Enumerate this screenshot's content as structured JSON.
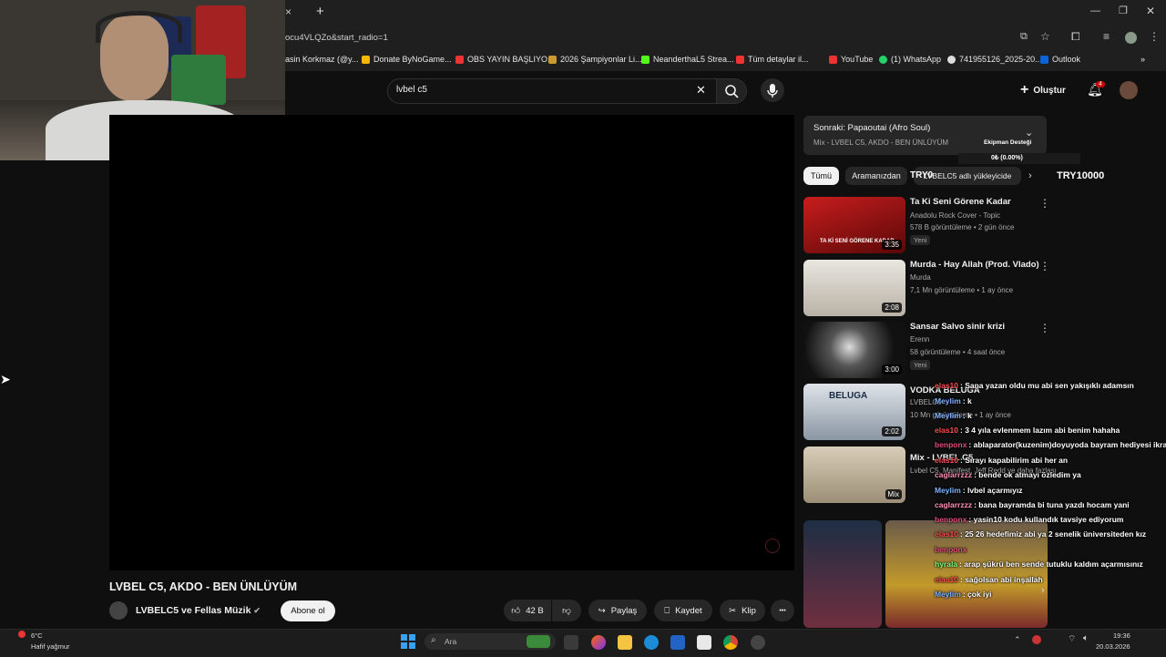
{
  "browser": {
    "url": "ocu4VLQZo&start_radio=1",
    "tab_close": "×",
    "new_tab": "+",
    "bookmarks": [
      {
        "label": "asin Korkmaz (@y...",
        "color": "#e33"
      },
      {
        "label": "Donate ByNoGame...",
        "color": "#f5b800"
      },
      {
        "label": "OBS YAYIN BAŞLIYO...",
        "color": "#e33"
      },
      {
        "label": "2026 Şampiyonlar Li...",
        "color": "#cc9a2e"
      },
      {
        "label": "NeanderthaL5 Strea...",
        "color": "#53fc18"
      },
      {
        "label": "Tüm detaylar il...",
        "color": "#e33"
      },
      {
        "label": "YouTube",
        "color": "#e33"
      },
      {
        "label": "(1) WhatsApp",
        "color": "#25d366"
      },
      {
        "label": "741955126_2025-20...",
        "color": "#ddd"
      },
      {
        "label": "Outlook",
        "color": "#0a64d8"
      }
    ]
  },
  "youtube": {
    "search_value": "lvbel c5",
    "create_label": "Oluştur",
    "notif_count": "4"
  },
  "up_next": {
    "title": "Sonraki: Papaoutai (Afro Soul)",
    "subtitle": "Mix - LVBEL C5, AKDO - BEN ÜNLÜYÜM",
    "team_label": "Ekipman Desteği",
    "progress_text": "0₺ (0.00%)"
  },
  "filters": {
    "all": "Tümü",
    "from_search": "Aramanızdan",
    "uploader": "LVBELC5 adlı yükleyicide",
    "donation_left": "TRY0",
    "donation_right": "TRY10000"
  },
  "videos": [
    {
      "title": "Ta Ki Seni Görene Kadar",
      "channel": "Anadolu Rock Cover - Topic",
      "meta": "578 B görüntüleme • 2 gün önce",
      "badge": "Yeni",
      "duration": "3:35",
      "thumb_text": "TA Kİ SENİ GÖRENE KADAR"
    },
    {
      "title": "Murda - Hay Allah (Prod. Vlado)",
      "channel": "Murda",
      "meta": "7,1 Mn görüntüleme • 1 ay önce",
      "duration": "2:08"
    },
    {
      "title": "Sansar Salvo sinir krizi",
      "channel": "Erenn",
      "meta": "58 görüntüleme • 4 saat önce",
      "badge": "Yeni",
      "duration": "3:00"
    },
    {
      "title": "VODKA BELUGA",
      "channel": "LVBELC5",
      "meta": "10 Mn görüntüleme • 1 ay önce",
      "duration": "2:02",
      "thumb_text": "BELUGA"
    },
    {
      "title": "Mix - LVBEL C5",
      "channel": "Lvbel C5, Manifest, Jeff Redd ve daha fazlası",
      "duration": "Mix"
    }
  ],
  "chat": [
    {
      "name": "elas10",
      "text": ": Sana yazan oldu mu abi sen yakışıklı adamsın",
      "color": "#ff4d4d"
    },
    {
      "name": "Meylim",
      "text": ": k",
      "color": "#7fb2ff"
    },
    {
      "name": "Meylim",
      "text": ": k",
      "color": "#7fb2ff"
    },
    {
      "name": "elas10",
      "text": ": 3 4 yıla evlenmem lazım abi benim hahaha",
      "color": "#ff4d4d"
    },
    {
      "name": "benponx",
      "text": ": ablaparator(kuzenim)doyuyoda bayram hediyesi ikram",
      "color": "#e04d7a"
    },
    {
      "name": "elas10",
      "text": ": Sırayı kapabilirim abi her an",
      "color": "#ff4d4d"
    },
    {
      "name": "caglarrzzz",
      "text": ": bende ok atmayı özledim ya",
      "color": "#ff8fb2"
    },
    {
      "name": "Meylim",
      "text": ": lvbel açarmıyız",
      "color": "#7fb2ff"
    },
    {
      "name": "caglarrzzz",
      "text": ": bana bayramda bi tuna yazdı hocam yani",
      "color": "#ff8fb2"
    },
    {
      "name": "benponx",
      "text": ": yasin10 kodu kullandık tavsiye ediyorum",
      "color": "#e04d7a"
    },
    {
      "name": "elas10",
      "text": ": 25 26 hedefimiz abi ya 2 senelik üniversiteden kız",
      "color": "#ff4d4d"
    },
    {
      "name": "benponx",
      "text": "",
      "color": "#e04d7a"
    },
    {
      "name": "hyrala",
      "text": ": arap şükrü ben sende tutuklu kaldım açarmısınız",
      "color": "#7dff7d"
    },
    {
      "name": "elas10",
      "text": ": sağolsan abi inşallah",
      "color": "#ff4d4d"
    },
    {
      "name": "Meylim",
      "text": ": çok iyi",
      "color": "#7fb2ff"
    }
  ],
  "video": {
    "title": "LVBEL C5, AKDO - BEN ÜNLÜYÜM",
    "channel": "LVBELC5 ve Fellas Müzik",
    "subscribe": "Abone ol",
    "likes": "42 B",
    "share": "Paylaş",
    "save": "Kaydet",
    "clip": "Klip",
    "more": "•••"
  },
  "taskbar": {
    "weather_temp": "6°C",
    "weather_desc": "Hafif yağmur",
    "search_placeholder": "Ara",
    "time": "19:36",
    "date": "20.03.2026"
  },
  "colors": {
    "youtube_red": "#ff0000",
    "accent_blue": "#3ea6ff"
  }
}
